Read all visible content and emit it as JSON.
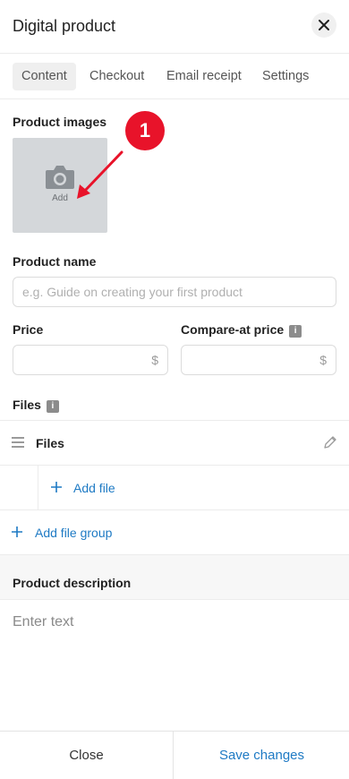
{
  "header": {
    "title": "Digital product"
  },
  "tabs": [
    {
      "label": "Content"
    },
    {
      "label": "Checkout"
    },
    {
      "label": "Email receipt"
    },
    {
      "label": "Settings"
    }
  ],
  "product_images": {
    "label": "Product images",
    "add_label": "Add"
  },
  "callout": {
    "number": "1"
  },
  "product_name": {
    "label": "Product name",
    "placeholder": "e.g. Guide on creating your first product",
    "value": ""
  },
  "price": {
    "label": "Price",
    "currency": "$"
  },
  "compare_price": {
    "label": "Compare-at price",
    "currency": "$"
  },
  "files": {
    "label": "Files",
    "group_name": "Files",
    "add_file_label": "Add file",
    "add_group_label": "Add file group"
  },
  "description": {
    "label": "Product description",
    "placeholder": "Enter text"
  },
  "footer": {
    "close_label": "Close",
    "save_label": "Save changes"
  },
  "colors": {
    "accent": "#1e7ac4",
    "callout": "#e8132a",
    "image_placeholder": "#d4d7da"
  },
  "icons": {
    "close": "close-icon",
    "camera": "camera-icon",
    "info": "info-icon",
    "drag": "drag-handle-icon",
    "edit": "pencil-icon",
    "plus": "plus-icon"
  }
}
